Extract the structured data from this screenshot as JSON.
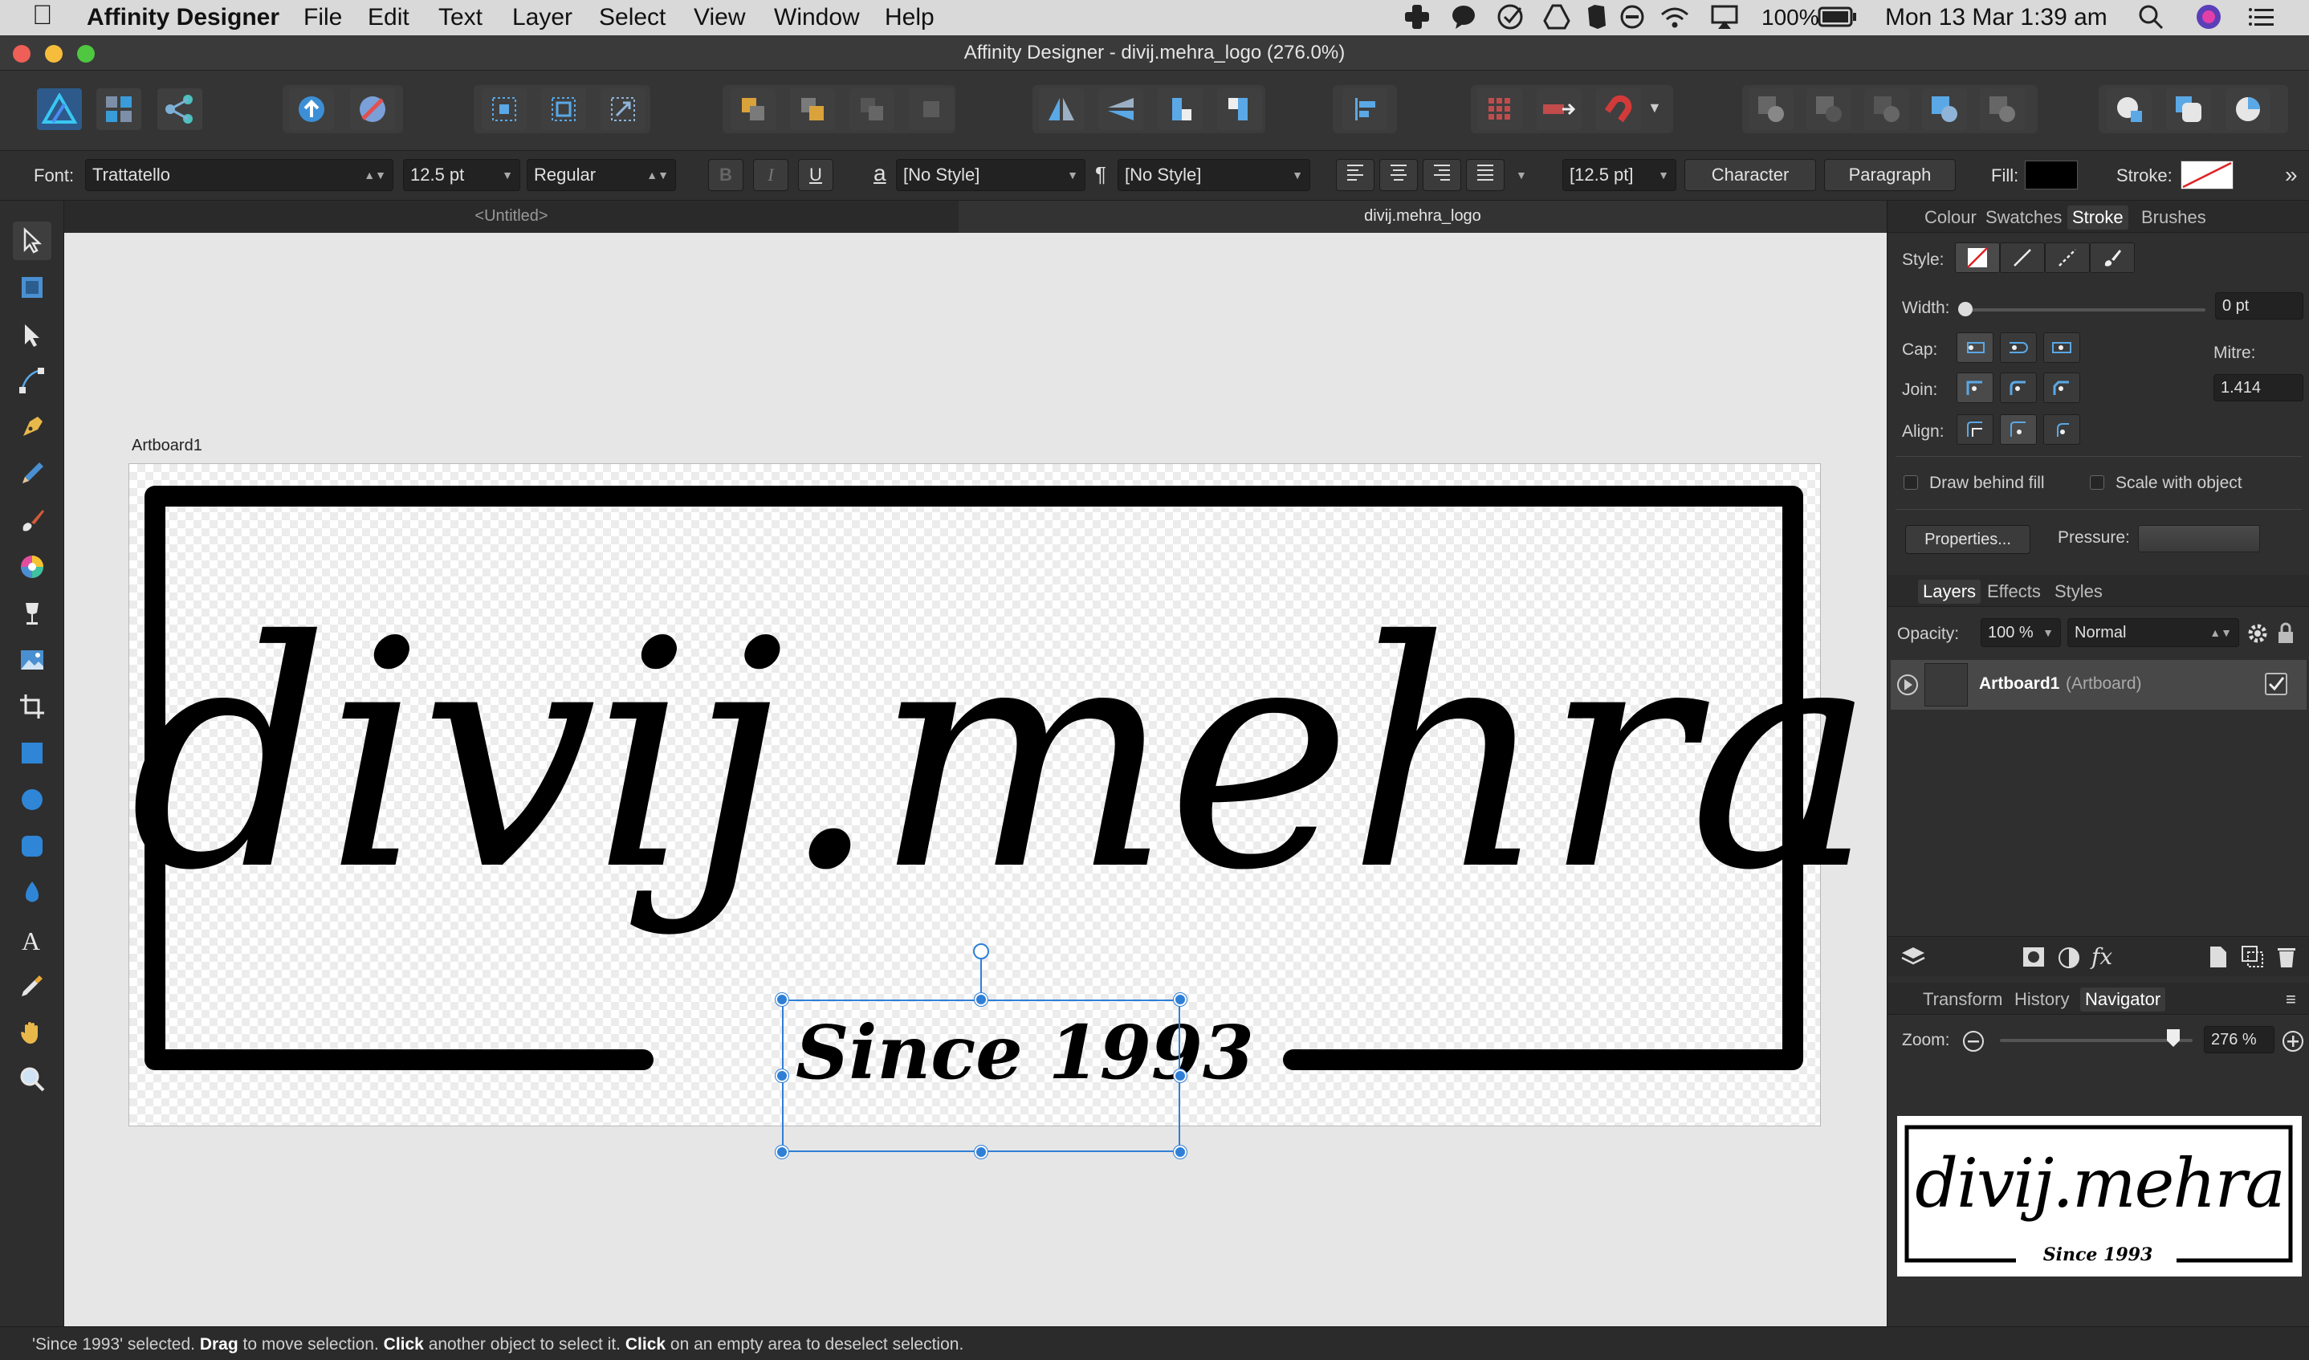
{
  "menubar": {
    "app_name": "Affinity Designer",
    "items": [
      "File",
      "Edit",
      "Text",
      "Layer",
      "Select",
      "View",
      "Window",
      "Help"
    ],
    "battery": "100%",
    "clock": "Mon 13 Mar  1:39 am"
  },
  "window": {
    "title": "Affinity Designer - divij.mehra_logo (276.0%)"
  },
  "context": {
    "font_label": "Font:",
    "font_value": "Trattatello",
    "size_value": "12.5 pt",
    "weight_value": "Regular",
    "bold": "B",
    "italic": "I",
    "underline": "U",
    "char_style_icon": "a",
    "char_style": "[No Style]",
    "para_style_icon": "¶",
    "para_style": "[No Style]",
    "leading": "[12.5 pt]",
    "character_button": "Character",
    "paragraph_button": "Paragraph",
    "fill_label": "Fill:",
    "stroke_label": "Stroke:"
  },
  "doc_tabs": {
    "untitled": "<Untitled>",
    "active": "divij.mehra_logo"
  },
  "canvas": {
    "artboard_label": "Artboard1",
    "logo_text": "divij.mehra",
    "since_text": "Since 1993"
  },
  "stroke_panel": {
    "tabs": [
      "Colour",
      "Swatches",
      "Stroke",
      "Brushes"
    ],
    "style_label": "Style:",
    "width_label": "Width:",
    "width_value": "0 pt",
    "cap_label": "Cap:",
    "mitre_label": "Mitre:",
    "join_label": "Join:",
    "mitre_value": "1.414",
    "align_label": "Align:",
    "draw_behind": "Draw behind fill",
    "scale_with": "Scale with object",
    "properties_button": "Properties...",
    "pressure_label": "Pressure:"
  },
  "layers_panel": {
    "tabs": [
      "Layers",
      "Effects",
      "Styles"
    ],
    "opacity_label": "Opacity:",
    "opacity_value": "100 %",
    "blend_value": "Normal",
    "layer_name": "Artboard1",
    "layer_type": "(Artboard)"
  },
  "navigator_panel": {
    "tabs": [
      "Transform",
      "History",
      "Navigator"
    ],
    "zoom_label": "Zoom:",
    "zoom_value": "276 %",
    "zoom_fraction": 0.9,
    "preview_logo": "divij.mehra",
    "preview_since": "Since 1993"
  },
  "status": {
    "sel": "'Since 1993' selected.",
    "drag": "Drag",
    "drag_t": "to move selection.",
    "click": "Click",
    "click_t": "another object to select it.",
    "click2": "Click",
    "click2_t": "on an empty area to deselect selection."
  }
}
